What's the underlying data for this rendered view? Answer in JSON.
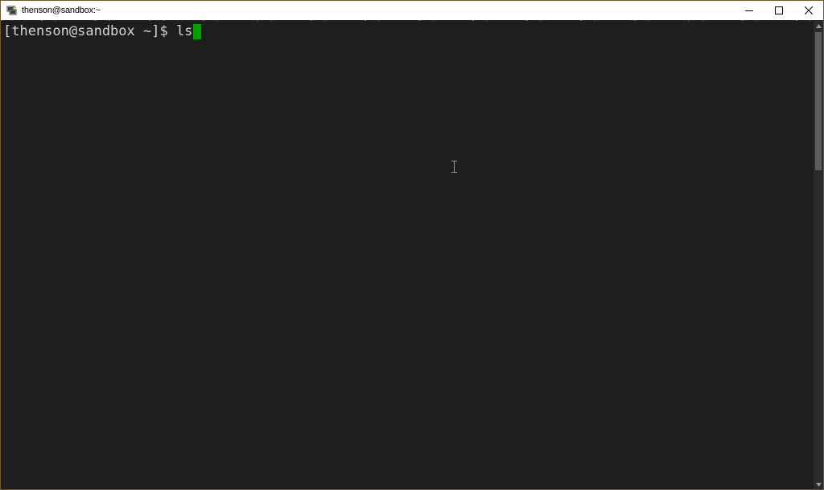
{
  "window": {
    "title": "thenson@sandbox:~"
  },
  "controls": {
    "minimize_icon": "minimize-icon",
    "maximize_icon": "maximize-icon",
    "close_icon": "close-icon"
  },
  "terminal": {
    "prompt": "[thenson@sandbox ~]$ ",
    "input": "ls",
    "cursor_color": "#00a000",
    "background_color": "#1e1e1e",
    "text_color": "#d4d4d4"
  },
  "scrollbar": {
    "position_fraction": 0.0
  }
}
